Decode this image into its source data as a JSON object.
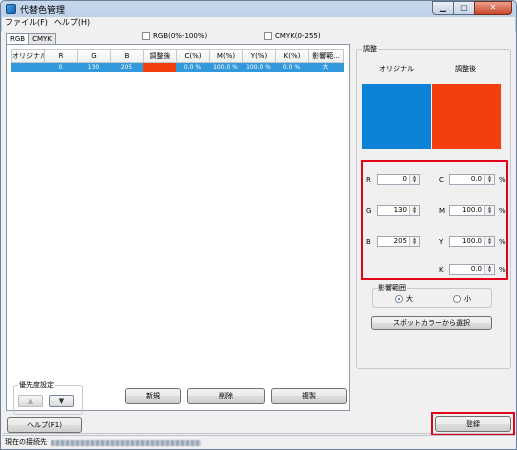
{
  "window": {
    "title": "代替色管理",
    "controls": {
      "minimize": "▁",
      "maximize": "▢",
      "close": "✕"
    }
  },
  "menu": {
    "file": "ファイル(F)",
    "help": "ヘルプ(H)"
  },
  "tabs": [
    {
      "label": "RGB",
      "active": true
    },
    {
      "label": "CMYK",
      "active": false
    }
  ],
  "checkboxes": {
    "rgb_percent": "RGB(0%-100%)",
    "cmyk_range": "CMYK(0-255)"
  },
  "table": {
    "headers": [
      "オリジナル",
      "R",
      "G",
      "B",
      "調整後",
      "C(%)",
      "M(%)",
      "Y(%)",
      "K(%)",
      "影響範..."
    ],
    "rows": [
      {
        "r": "0",
        "g": "130",
        "b": "205",
        "c": "0.0 %",
        "m": "100.0 %",
        "y": "100.0 %",
        "k": "0.0 %",
        "range": "大"
      }
    ]
  },
  "priority": {
    "label": "優先度設定",
    "up": "▲",
    "down": "▼"
  },
  "buttons": {
    "new": "新規",
    "delete": "削除",
    "duplicate": "複製",
    "help": "ヘルプ(F1)",
    "register": "登録",
    "spot": "スポットカラーから選択"
  },
  "adjust": {
    "label": "調整",
    "original_label": "オリジナル",
    "adjusted_label": "調整後",
    "original_color": "#0c83d6",
    "adjusted_color": "#f23f0b",
    "fields": {
      "R": "0",
      "G": "130",
      "B": "205",
      "C": "0.0",
      "M": "100.0",
      "Y": "100.0",
      "K": "0.0"
    },
    "percent": "%"
  },
  "range": {
    "label": "影響範囲",
    "large": "大",
    "small": "小",
    "selected": "大"
  },
  "status": {
    "label": "現在の接続先"
  },
  "colors": {
    "highlight": "#e0001a",
    "selection": "#3399dd"
  }
}
